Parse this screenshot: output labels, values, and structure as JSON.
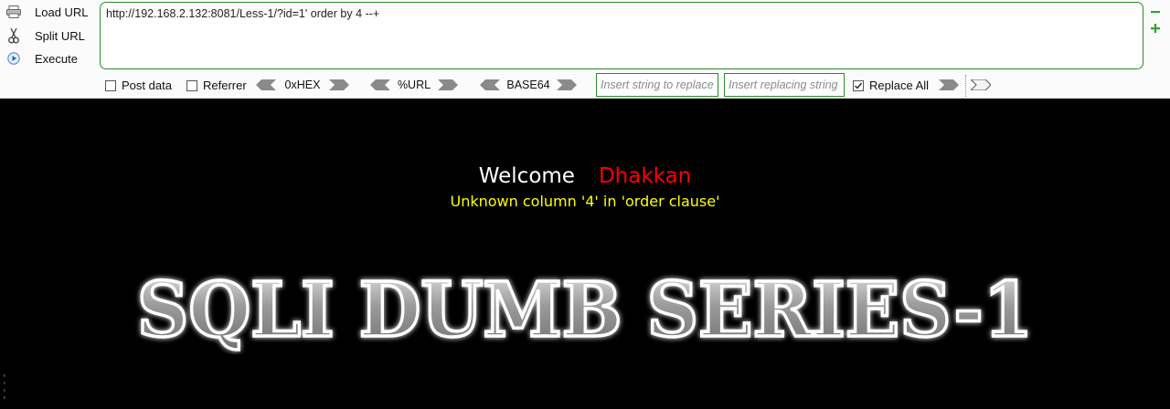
{
  "sidebar": {
    "load_url": "Load URL",
    "split_url": "Split URL",
    "execute": "Execute"
  },
  "url_field": {
    "value": "http://192.168.2.132:8081/Less-1/?id=1' order by 4 --+"
  },
  "options": {
    "post_data": "Post data",
    "referrer": "Referrer",
    "hex": "0xHEX",
    "url": "%URL",
    "base64": "BASE64",
    "replace_placeholder": "Insert string to replace",
    "replacing_placeholder": "Insert replacing string",
    "replace_all": "Replace All",
    "replace_all_checked": true
  },
  "page": {
    "welcome": "Welcome",
    "user": "Dhakkan",
    "error": "Unknown column '4' in 'order clause'",
    "logo_text": "SQLI DUMB SERIES-1"
  },
  "colors": {
    "accent_green": "#2b8a2b",
    "user_red": "#ff0000",
    "error_yellow": "#ffff00"
  }
}
